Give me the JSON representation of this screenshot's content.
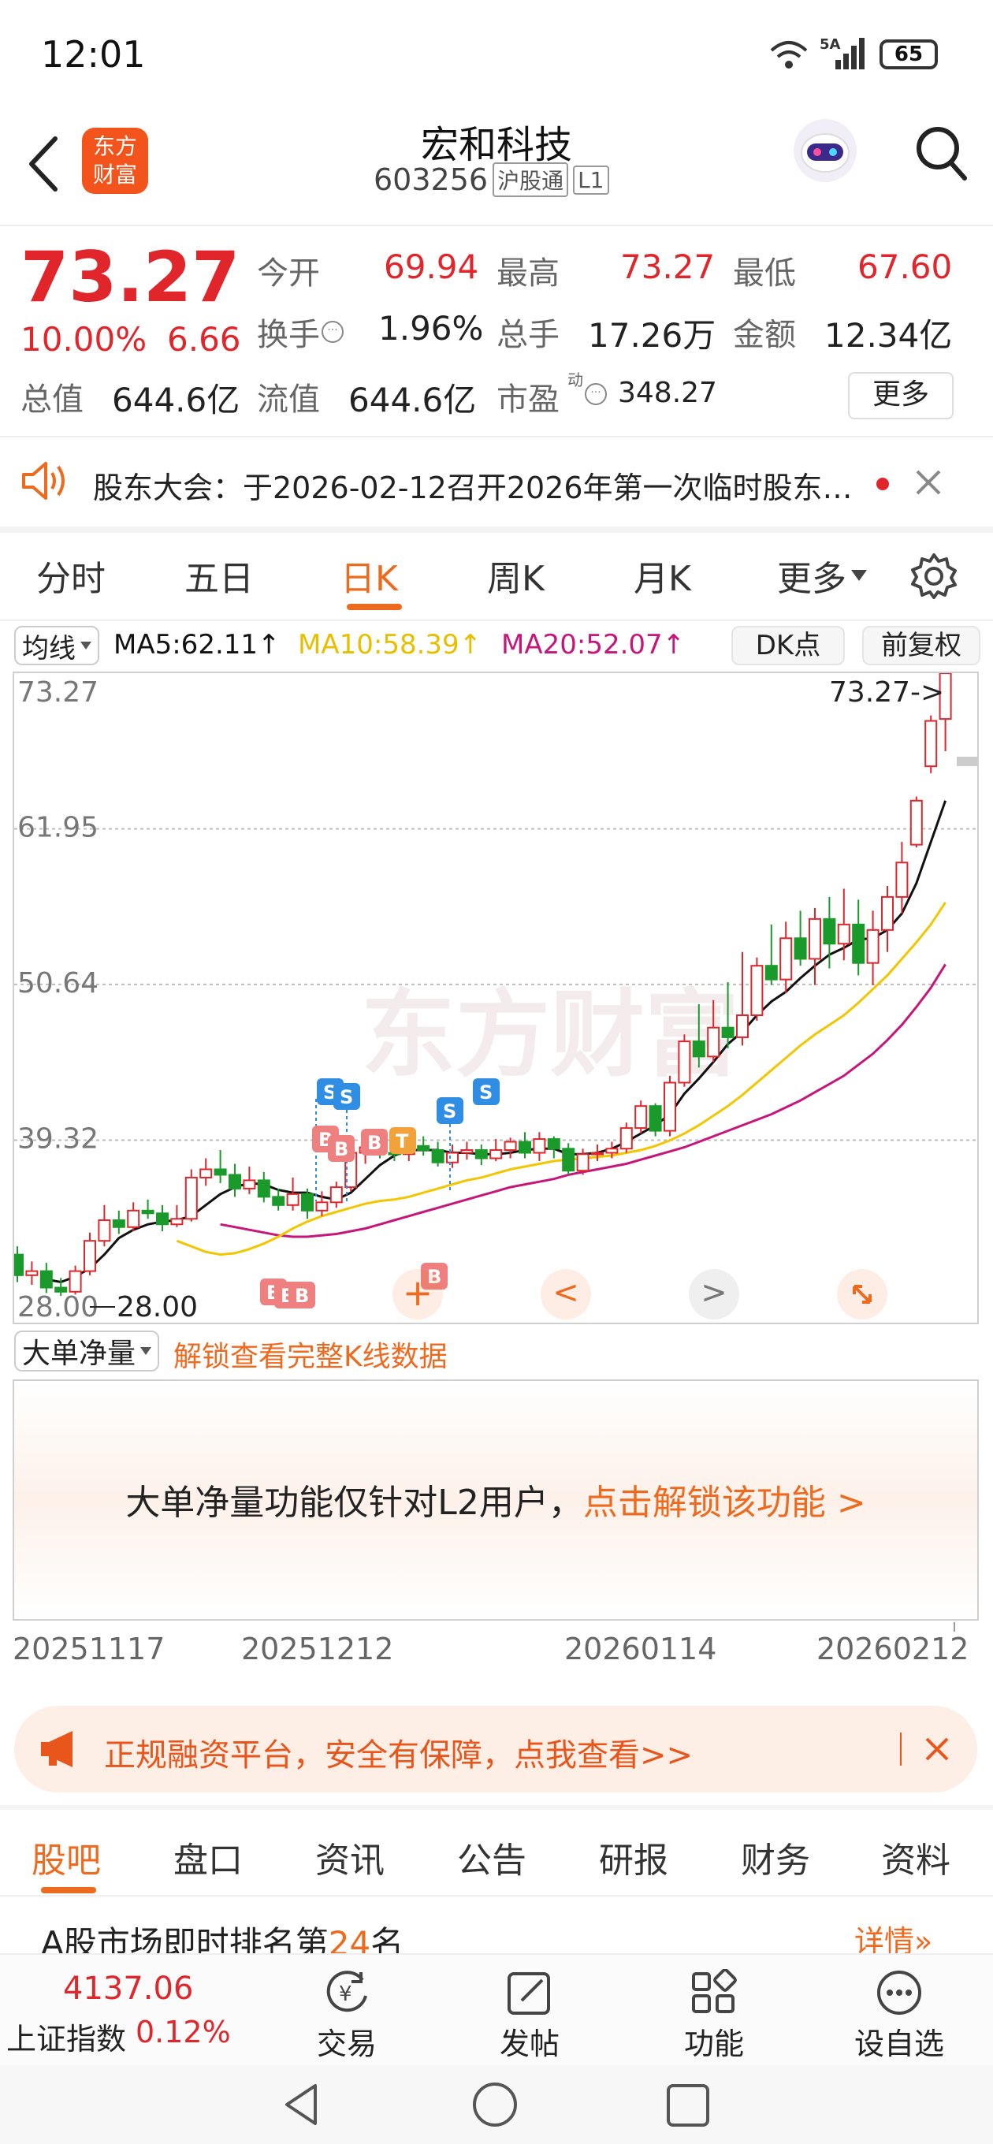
{
  "status_bar": {
    "time": "12:01",
    "network": "5A",
    "battery": "65"
  },
  "header": {
    "logo_line1": "东方",
    "logo_line2": "财富",
    "stock_name": "宏和科技",
    "stock_code": "603256",
    "tag_connect": "沪股通",
    "tag_level": "L1"
  },
  "quote": {
    "price": "73.27",
    "change_pct": "10.00%",
    "change_amt": "6.66",
    "open_label": "今开",
    "open": "69.94",
    "high_label": "最高",
    "high": "73.27",
    "low_label": "最低",
    "low": "67.60",
    "turnover_label": "换手",
    "turnover": "1.96%",
    "volume_label": "总手",
    "volume": "17.26万",
    "amount_label": "金额",
    "amount": "12.34亿",
    "mktcap_label": "总值",
    "mktcap": "644.6亿",
    "float_label": "流值",
    "float": "644.6亿",
    "pe_label": "市盈",
    "pe_sup": "动",
    "pe": "348.27",
    "more_label": "更多"
  },
  "notice": {
    "text": "股东大会：于2026-02-12召开2026年第一次临时股东…"
  },
  "period_tabs": [
    "分时",
    "五日",
    "日K",
    "周K",
    "月K",
    "更多"
  ],
  "active_period": "日K",
  "ma_bar": {
    "indicator": "均线",
    "ma5": "MA5:62.11",
    "ma10": "MA10:58.39",
    "ma20": "MA20:52.07",
    "dk_label": "DK点",
    "adjust_label": "前复权"
  },
  "colors": {
    "up": "#e0262b",
    "down": "#1a9a2a",
    "ma5": "#111111",
    "ma10": "#f2c600",
    "ma20": "#c8157a",
    "accent": "#ee6a1f"
  },
  "chart_data": {
    "type": "candlestick",
    "y_ticks": [
      "73.27",
      "61.95",
      "50.64",
      "39.32",
      "28.00"
    ],
    "ylim": [
      28.0,
      73.27
    ],
    "max_label": "73.27->",
    "min_label": "28.00",
    "x_labels": [
      "20251117",
      "20251212",
      "20260114",
      "20260212"
    ],
    "candles": [
      [
        31.0,
        29.5,
        31.6,
        29.0
      ],
      [
        29.5,
        29.8,
        30.5,
        28.8
      ],
      [
        29.8,
        28.6,
        30.4,
        28.2
      ],
      [
        28.6,
        28.3,
        29.3,
        28.0
      ],
      [
        28.3,
        29.8,
        30.2,
        28.1
      ],
      [
        29.8,
        32.0,
        32.6,
        29.5
      ],
      [
        32.0,
        33.5,
        34.6,
        31.6
      ],
      [
        33.5,
        33.0,
        34.2,
        32.5
      ],
      [
        33.0,
        34.2,
        34.8,
        32.7
      ],
      [
        34.2,
        34.0,
        35.0,
        33.6
      ],
      [
        34.0,
        33.2,
        34.6,
        32.7
      ],
      [
        33.2,
        33.6,
        34.6,
        33.0
      ],
      [
        33.6,
        36.6,
        37.2,
        33.4
      ],
      [
        36.6,
        37.2,
        38.0,
        36.0
      ],
      [
        37.2,
        36.8,
        38.6,
        36.2
      ],
      [
        36.8,
        35.8,
        37.6,
        35.2
      ],
      [
        35.8,
        36.4,
        37.4,
        35.4
      ],
      [
        36.4,
        35.2,
        37.0,
        34.8
      ],
      [
        35.2,
        34.6,
        35.8,
        34.2
      ],
      [
        34.6,
        35.4,
        36.6,
        34.2
      ],
      [
        35.4,
        34.2,
        35.8,
        33.6
      ],
      [
        34.2,
        34.8,
        35.6,
        33.8
      ],
      [
        34.8,
        35.9,
        36.3,
        34.4
      ],
      [
        35.9,
        38.4,
        38.8,
        35.6
      ],
      [
        38.4,
        38.8,
        39.4,
        37.6
      ],
      [
        38.8,
        38.4,
        39.8,
        38.0
      ],
      [
        38.4,
        38.3,
        39.2,
        37.8
      ],
      [
        38.3,
        38.9,
        39.4,
        37.8
      ],
      [
        38.9,
        38.6,
        39.6,
        38.2
      ],
      [
        38.6,
        37.7,
        39.2,
        37.4
      ],
      [
        37.7,
        38.4,
        39.0,
        37.3
      ],
      [
        38.4,
        38.6,
        39.2,
        37.9
      ],
      [
        38.6,
        38.0,
        39.0,
        37.5
      ],
      [
        38.0,
        38.6,
        39.4,
        37.8
      ],
      [
        38.6,
        39.2,
        39.5,
        38.0
      ],
      [
        39.2,
        38.4,
        39.9,
        38.0
      ],
      [
        38.4,
        39.4,
        39.9,
        37.8
      ],
      [
        39.4,
        38.7,
        39.6,
        38.0
      ],
      [
        38.7,
        37.1,
        39.1,
        36.8
      ],
      [
        37.1,
        38.3,
        38.7,
        36.8
      ],
      [
        38.3,
        38.4,
        39.0,
        37.8
      ],
      [
        38.4,
        38.7,
        39.2,
        38.0
      ],
      [
        38.7,
        40.2,
        40.6,
        38.4
      ],
      [
        40.2,
        41.8,
        42.2,
        39.8
      ],
      [
        41.8,
        40.0,
        42.0,
        39.6
      ],
      [
        40.0,
        43.5,
        44.0,
        39.6
      ],
      [
        43.5,
        46.5,
        47.0,
        43.2
      ],
      [
        46.5,
        45.4,
        49.2,
        44.6
      ],
      [
        45.4,
        47.5,
        49.5,
        45.0
      ],
      [
        47.5,
        46.8,
        50.8,
        46.0
      ],
      [
        46.8,
        48.4,
        53.0,
        46.2
      ],
      [
        48.4,
        52.0,
        52.6,
        48.0
      ],
      [
        52.0,
        51.0,
        55.0,
        50.6
      ],
      [
        51.0,
        54.0,
        55.2,
        50.0
      ],
      [
        54.0,
        52.5,
        56.0,
        52.0
      ],
      [
        52.5,
        55.4,
        56.2,
        50.6
      ],
      [
        55.4,
        53.6,
        57.0,
        51.8
      ],
      [
        53.6,
        55.0,
        57.6,
        52.4
      ],
      [
        55.0,
        52.2,
        56.8,
        51.3
      ],
      [
        52.2,
        54.6,
        56.0,
        50.6
      ],
      [
        54.6,
        57.0,
        57.8,
        53.0
      ],
      [
        57.0,
        59.5,
        61.0,
        55.8
      ],
      [
        60.8,
        64.0,
        64.3,
        60.6
      ],
      [
        66.5,
        69.8,
        70.2,
        66.0
      ],
      [
        69.94,
        73.27,
        73.27,
        67.6
      ]
    ],
    "ma5": [
      29.2,
      29.0,
      29.4,
      30.0,
      31.0,
      32.2,
      32.8,
      33.2,
      33.4,
      33.5,
      33.8,
      34.6,
      35.4,
      35.9,
      36.2,
      36.1,
      35.7,
      35.5,
      35.5,
      35.2,
      35.0,
      35.5,
      36.5,
      37.5,
      38.2,
      38.6,
      38.6,
      38.6,
      38.4,
      38.4,
      38.3,
      38.3,
      38.4,
      38.6,
      38.7,
      38.7,
      38.3,
      38.3,
      38.4,
      38.7,
      39.2,
      39.8,
      40.4,
      41.2,
      42.7,
      43.8,
      45.0,
      46.3,
      47.2,
      48.4,
      49.4,
      50.1,
      51.1,
      52.0,
      52.8,
      53.3,
      53.9,
      54.0,
      54.6,
      55.8,
      58.0,
      61.0,
      64.0
    ],
    "ma10": [
      32.0,
      31.6,
      31.2,
      31.0,
      31.1,
      31.4,
      31.8,
      32.3,
      32.9,
      33.4,
      33.8,
      34.1,
      34.4,
      34.7,
      34.9,
      35.0,
      35.2,
      35.5,
      35.8,
      36.1,
      36.4,
      36.6,
      36.9,
      37.2,
      37.4,
      37.6,
      37.8,
      37.9,
      38.0,
      38.1,
      38.2,
      38.4,
      38.6,
      38.9,
      39.3,
      39.8,
      40.4,
      41.1,
      41.8,
      42.6,
      43.5,
      44.4,
      45.3,
      46.2,
      47.0,
      47.7,
      48.4,
      49.3,
      50.3,
      51.3,
      52.5,
      53.7,
      55.0,
      56.6
    ],
    "ma20": [
      33.2,
      33.0,
      32.8,
      32.6,
      32.4,
      32.3,
      32.3,
      32.4,
      32.5,
      32.7,
      32.9,
      33.2,
      33.5,
      33.8,
      34.1,
      34.4,
      34.7,
      35.0,
      35.3,
      35.6,
      35.9,
      36.1,
      36.3,
      36.5,
      36.8,
      37.0,
      37.2,
      37.4,
      37.6,
      37.9,
      38.2,
      38.5,
      38.8,
      39.2,
      39.6,
      40.0,
      40.4,
      40.8,
      41.2,
      41.7,
      42.2,
      42.8,
      43.4,
      44.0,
      44.8,
      45.6,
      46.6,
      47.7,
      49.0,
      50.4,
      52.1
    ]
  },
  "big_order": {
    "label": "大单净量",
    "unlock_link": "解锁查看完整K线数据",
    "panel_text": "大单净量功能仅针对L2用户，",
    "panel_link": "点击解锁该功能 >"
  },
  "banner": {
    "text": "正规融资平台，安全有保障，点我查看>>"
  },
  "info_tabs": [
    "股吧",
    "盘口",
    "资讯",
    "公告",
    "研报",
    "财务",
    "资料"
  ],
  "active_info_tab": "股吧",
  "rank": {
    "prefix": "A股市场即时排名第",
    "rank": "24",
    "suffix": "名",
    "detail": "详情"
  },
  "bottom_bar": {
    "index_value": "4137.06",
    "index_name": "上证指数",
    "index_change": "0.12%",
    "items": [
      "交易",
      "发帖",
      "功能",
      "设自选"
    ]
  }
}
